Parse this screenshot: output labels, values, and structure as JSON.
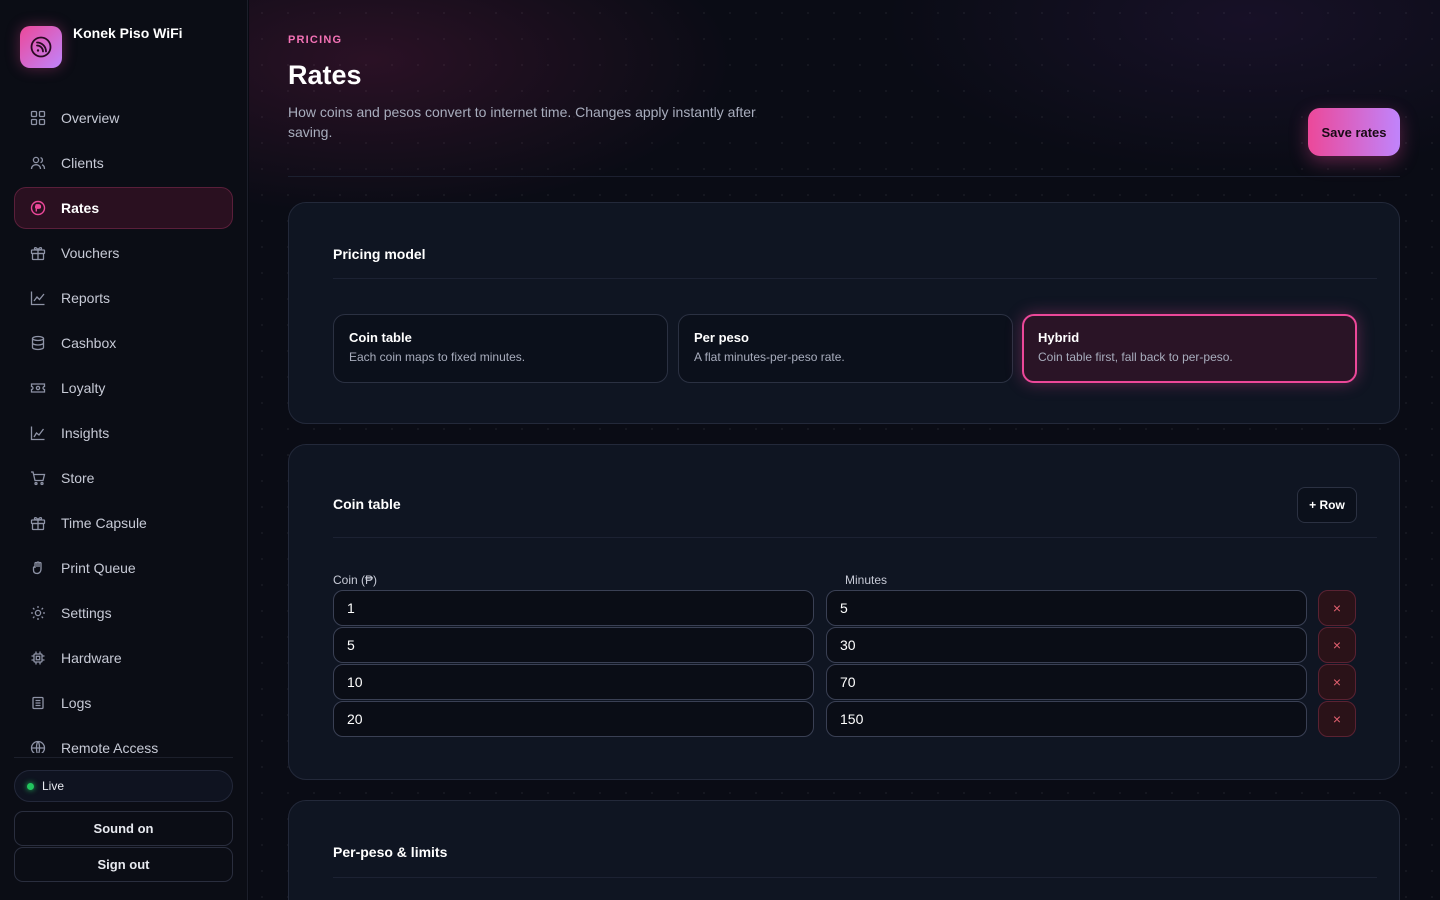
{
  "app": {
    "name": "Konek Piso WiFi"
  },
  "sidebar": {
    "items": [
      {
        "label": "Overview",
        "icon": "grid-icon",
        "active": false
      },
      {
        "label": "Clients",
        "icon": "users-icon",
        "active": false
      },
      {
        "label": "Rates",
        "icon": "peso-icon",
        "active": true
      },
      {
        "label": "Vouchers",
        "icon": "gift-icon",
        "active": false
      },
      {
        "label": "Reports",
        "icon": "chart-line-icon",
        "active": false
      },
      {
        "label": "Cashbox",
        "icon": "database-icon",
        "active": false
      },
      {
        "label": "Loyalty",
        "icon": "ticket-icon",
        "active": false
      },
      {
        "label": "Insights",
        "icon": "trend-icon",
        "active": false
      },
      {
        "label": "Store",
        "icon": "cart-icon",
        "active": false
      },
      {
        "label": "Time Capsule",
        "icon": "gift-icon",
        "active": false
      },
      {
        "label": "Print Queue",
        "icon": "hand-icon",
        "active": false
      },
      {
        "label": "Settings",
        "icon": "sun-gear-icon",
        "active": false
      },
      {
        "label": "Hardware",
        "icon": "chip-icon",
        "active": false
      },
      {
        "label": "Logs",
        "icon": "list-icon",
        "active": false
      },
      {
        "label": "Remote Access",
        "icon": "globe-icon",
        "active": false
      }
    ],
    "status": "Live",
    "sound_label": "Sound on",
    "signout_label": "Sign out"
  },
  "header": {
    "eyebrow": "PRICING",
    "title": "Rates",
    "subtitle": "How coins and pesos convert to internet time. Changes apply instantly after saving.",
    "save_label": "Save rates"
  },
  "pricing_model": {
    "title": "Pricing model",
    "options": [
      {
        "title": "Coin table",
        "desc": "Each coin maps to fixed minutes.",
        "selected": false
      },
      {
        "title": "Per peso",
        "desc": "A flat minutes-per-peso rate.",
        "selected": false
      },
      {
        "title": "Hybrid",
        "desc": "Coin table first, fall back to per-peso.",
        "selected": true
      }
    ]
  },
  "coin_table": {
    "title": "Coin table",
    "add_label": "+ Row",
    "coin_header": "Coin (₱)",
    "minutes_header": "Minutes",
    "rows": [
      {
        "coin": "1",
        "minutes": "5"
      },
      {
        "coin": "5",
        "minutes": "30"
      },
      {
        "coin": "10",
        "minutes": "70"
      },
      {
        "coin": "20",
        "minutes": "150"
      }
    ],
    "delete_glyph": "×"
  },
  "limits": {
    "title": "Per-peso & limits"
  },
  "colors": {
    "accent": "#ec4899",
    "accent2": "#c084fc",
    "live": "#22c55e",
    "danger": "#e2606f"
  }
}
